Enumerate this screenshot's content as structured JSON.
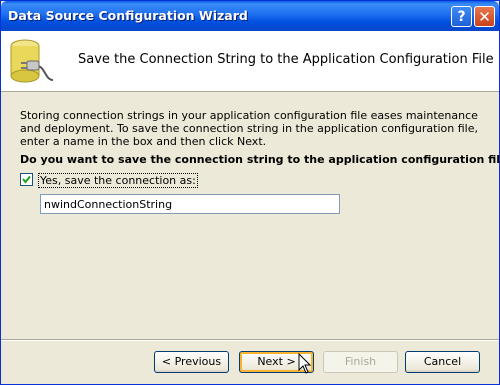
{
  "window": {
    "title": "Data Source Configuration Wizard"
  },
  "titlebar": {
    "help_glyph": "?",
    "close_glyph": "✕"
  },
  "header": {
    "title": "Save the Connection String to the Application Configuration File",
    "icon": "database-plug-icon"
  },
  "body": {
    "description": "Storing connection strings in your application configuration file eases maintenance and deployment. To save the connection string in the application configuration file, enter a name in the box and then click Next.",
    "question": "Do you want to save the connection string to the application configuration file?",
    "checkbox_label": "Yes, save the connection as:",
    "checkbox_checked": true,
    "name_value": "nwindConnectionString"
  },
  "buttons": {
    "previous": "< Previous",
    "next": "Next >",
    "finish": "Finish",
    "cancel": "Cancel"
  },
  "colors": {
    "titlebar": "#0a5fe8",
    "accent_border": "#f8b332",
    "face": "#ece9d8"
  }
}
